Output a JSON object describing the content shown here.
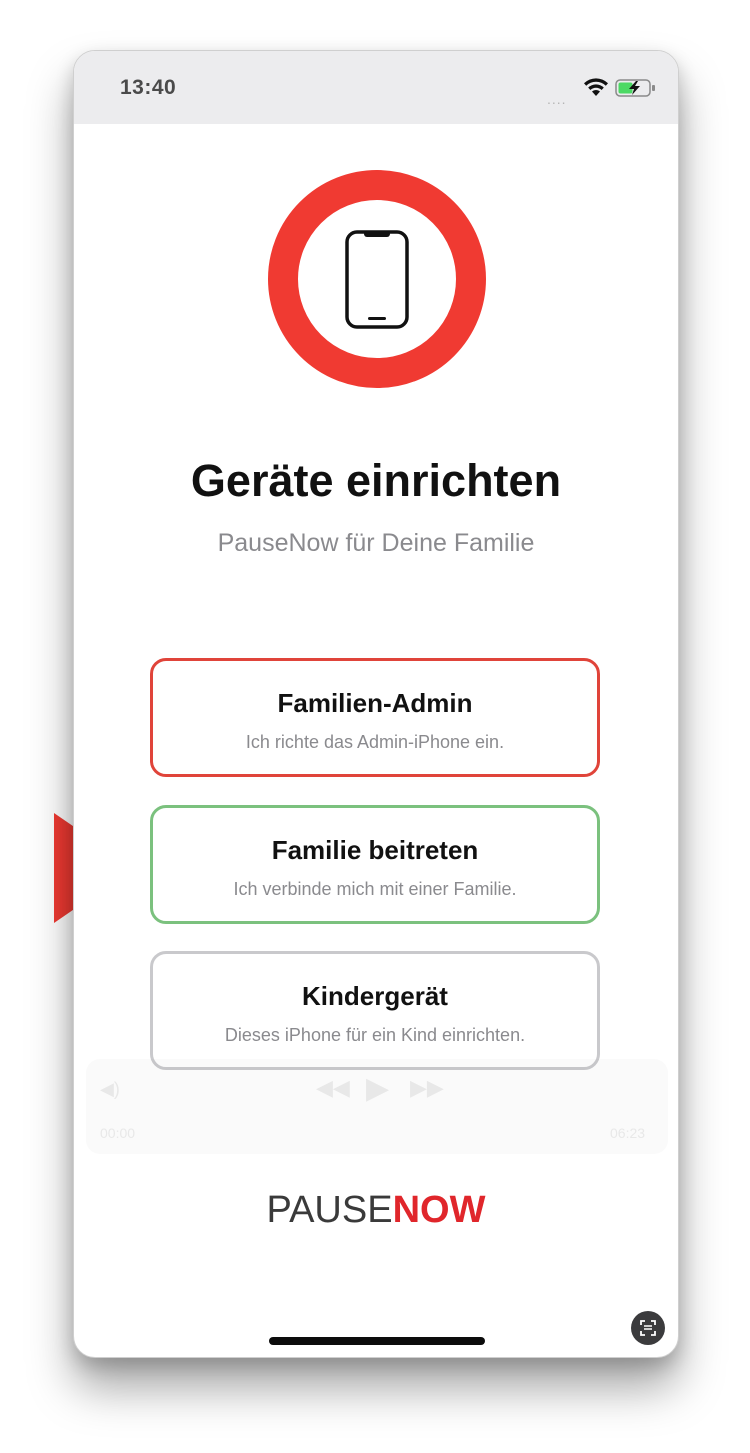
{
  "status_bar": {
    "time": "13:40",
    "signal_dots": "....",
    "wifi_icon": "wifi-icon",
    "battery_icon": "battery-charging-icon"
  },
  "hero": {
    "icon": "smartphone-icon",
    "ring_color": "#f03a32"
  },
  "heading": {
    "title": "Geräte einrichten",
    "subtitle": "PauseNow für Deine Familie"
  },
  "options": [
    {
      "title": "Familien-Admin",
      "subtitle": "Ich richte das Admin-iPhone ein.",
      "border_color": "#e0443a"
    },
    {
      "title": "Familie beitreten",
      "subtitle": "Ich verbinde mich mit einer Familie.",
      "border_color": "#7bc17e"
    },
    {
      "title": "Kindergerät",
      "subtitle": "Dieses iPhone für ein Kind einrichten.",
      "border_color": "#c9c9cc"
    }
  ],
  "media_overlay": {
    "elapsed": "00:00",
    "remaining": "06:23"
  },
  "brand": {
    "part1": "PAUSE",
    "part2": "NOW",
    "accent": "#e0262b"
  },
  "annotation": {
    "arrow_color": "#f03a32",
    "points_to": "Familie beitreten"
  }
}
